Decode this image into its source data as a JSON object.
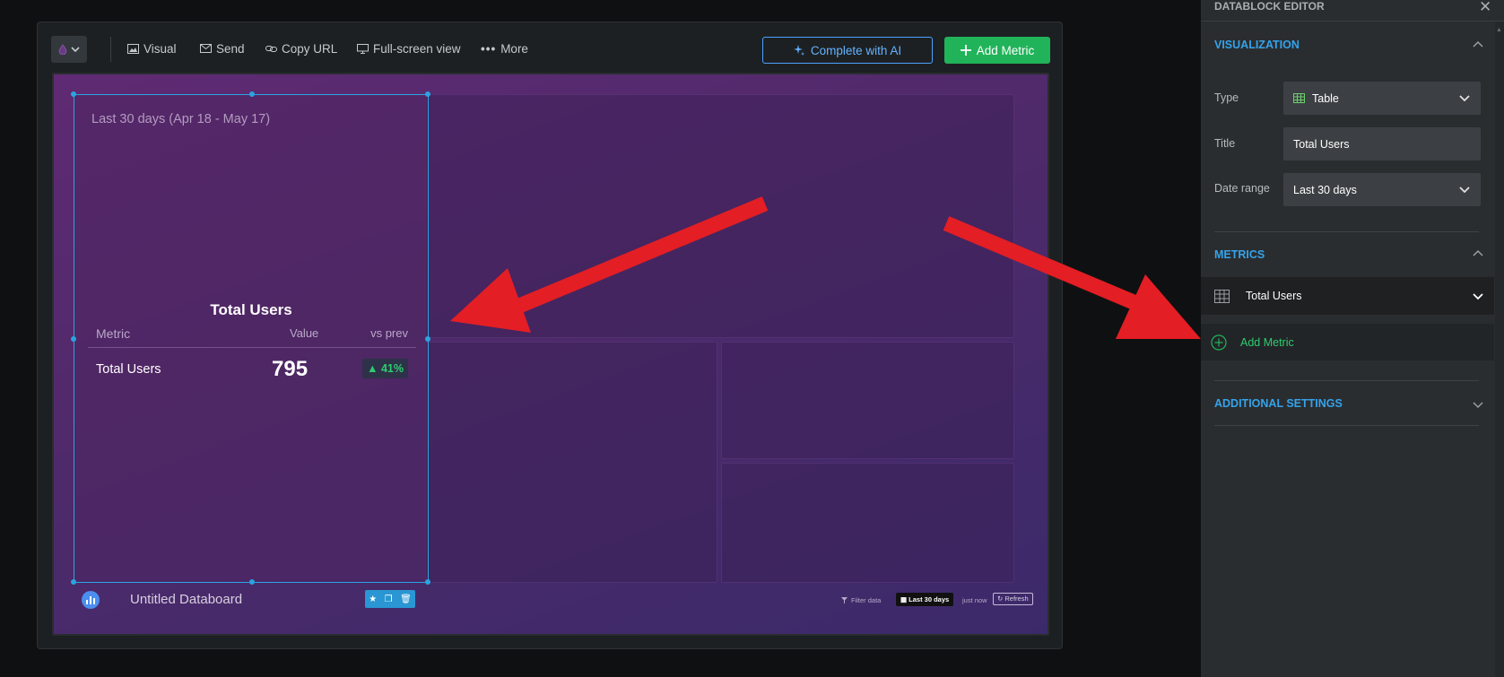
{
  "toolbar": {
    "theme_icon": "drop-icon",
    "visual_label": "Visual",
    "send_label": "Send",
    "copy_url_label": "Copy URL",
    "fullscreen_label": "Full-screen view",
    "more_label": "More",
    "ai_label": "Complete with AI",
    "add_metric_label": "Add Metric"
  },
  "board": {
    "date_caption": "Last 30 days (Apr 18 - May 17)",
    "table": {
      "title": "Total Users",
      "columns": [
        "Metric",
        "Value",
        "vs prev"
      ],
      "rows": [
        {
          "metric": "Total Users",
          "value": "795",
          "change": "▲ 41%"
        }
      ]
    },
    "footer": {
      "title": "Untitled Databoard",
      "filter_label": "Filter data",
      "date_range": "Last 30 days",
      "updated": "just now",
      "refresh_label": "Refresh"
    }
  },
  "editor": {
    "title": "DATABLOCK EDITOR",
    "visualization_label": "VISUALIZATION",
    "type_label": "Type",
    "type_value": "Table",
    "title_label": "Title",
    "title_value": "Total Users",
    "date_range_label": "Date range",
    "date_range_value": "Last 30 days",
    "metrics_label": "METRICS",
    "metric_item": "Total Users",
    "add_metric_label": "Add Metric",
    "additional_settings_label": "ADDITIONAL SETTINGS"
  },
  "colors": {
    "accent_blue": "#35a3ea",
    "accent_green": "#21b35a",
    "arrow_red": "#e31e24",
    "board_purple": "#5f2a73"
  }
}
